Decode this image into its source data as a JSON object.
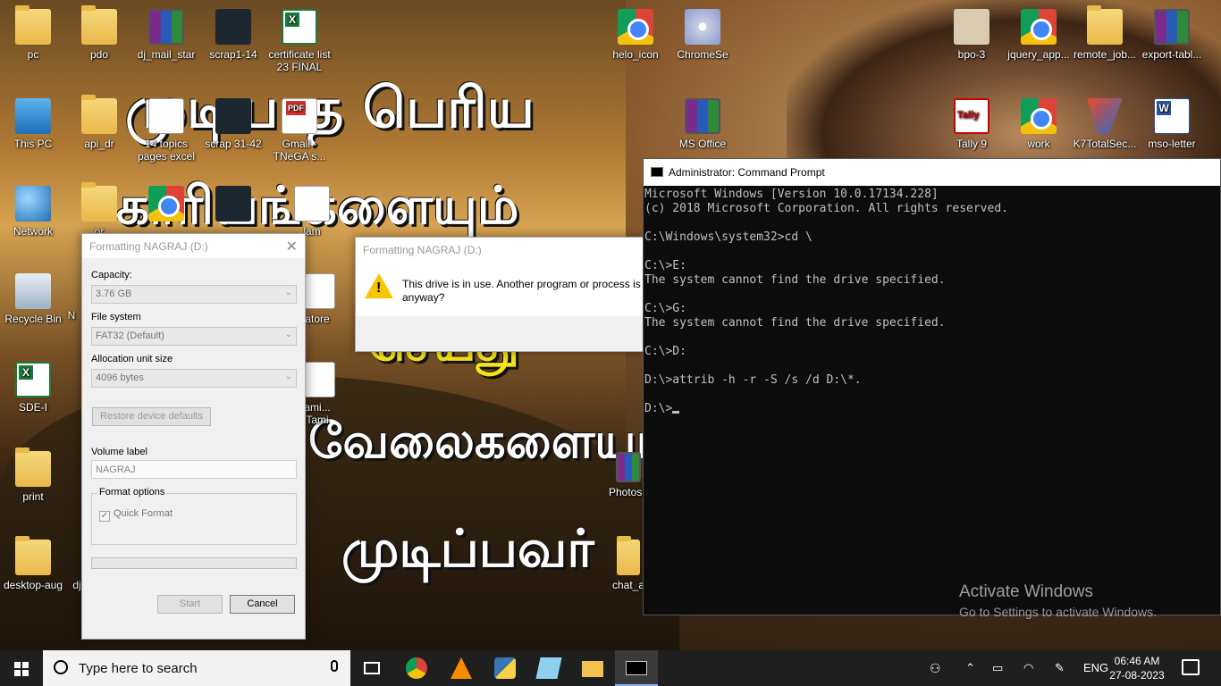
{
  "desktop": {
    "icons": [
      {
        "label": "pc",
        "icon": "user-folder-icon"
      },
      {
        "label": "pdo",
        "icon": "document-folder-icon"
      },
      {
        "label": "dj_mail_star",
        "icon": "winrar-archive-icon"
      },
      {
        "label": "scrap1-14",
        "icon": "screenshot-file-icon"
      },
      {
        "label": "certificate list 23 FINAL",
        "icon": "excel-file-icon"
      },
      {
        "label": "This PC",
        "icon": "computer-icon"
      },
      {
        "label": "api_dr",
        "icon": "folder-icon"
      },
      {
        "label": "14 topics pages excel",
        "icon": "spreadsheet-file-icon"
      },
      {
        "label": "scrap 31-42",
        "icon": "screenshot-file-icon"
      },
      {
        "label": "Gmail - TNeGA s...",
        "icon": "pdf-file-icon"
      },
      {
        "label": "Network",
        "icon": "network-icon"
      },
      {
        "label": "Recycle Bin",
        "icon": "recycle-bin-icon"
      },
      {
        "label": "SDE-I",
        "icon": "excel-file-icon"
      },
      {
        "label": "print",
        "icon": "document-folder-icon"
      },
      {
        "label": "desktop-aug",
        "icon": "document-folder-icon"
      },
      {
        "label": "helo_icon",
        "icon": "chrome-icon"
      },
      {
        "label": "ChromeSe",
        "icon": "cd-installer-icon"
      },
      {
        "label": "MS Office",
        "icon": "winrar-archive-icon"
      },
      {
        "label": "Photosh",
        "icon": "winrar-archive-icon"
      },
      {
        "label": "chat_a",
        "icon": "folder-icon"
      },
      {
        "label": "bpo-3",
        "icon": "image-file-icon"
      },
      {
        "label": "jquery_app...",
        "icon": "chrome-icon"
      },
      {
        "label": "remote_job...",
        "icon": "document-folder-icon"
      },
      {
        "label": "export-tabl...",
        "icon": "winrar-archive-icon"
      },
      {
        "label": "Tally 9",
        "icon": "tally-icon"
      },
      {
        "label": "work",
        "icon": "chrome-icon"
      },
      {
        "label": "K7TotalSec...",
        "icon": "k7-antivirus-icon"
      },
      {
        "label": "mso-letter",
        "icon": "word-file-icon"
      }
    ],
    "partial_labels": {
      "or": "or",
      "lam": "lam",
      "atore": "atore",
      "ami": "ami...",
      "tami": "Tami",
      "n": "N",
      "dj": "dj"
    },
    "wallpaper_text": {
      "line1": "முடியாத பெரிய",
      "line2": "காரியங்களையும்",
      "line3": "செய்து",
      "line4": "வேலைகளையும்",
      "line5": "முடிப்பவர்"
    }
  },
  "format_dialog": {
    "title": "Formatting NAGRAJ (D:)",
    "capacity_label": "Capacity:",
    "capacity_value": "3.76 GB",
    "filesystem_label": "File system",
    "filesystem_value": "FAT32 (Default)",
    "allocation_label": "Allocation unit size",
    "allocation_value": "4096 bytes",
    "restore_button": "Restore device defaults",
    "volume_label_label": "Volume label",
    "volume_label_value": "NAGRAJ",
    "format_options_label": "Format options",
    "quick_format_label": "Quick Format",
    "quick_format_checked": true,
    "progress": 0,
    "start_button": "Start",
    "cancel_button": "Cancel"
  },
  "warning_dialog": {
    "title": "Formatting NAGRAJ (D:)",
    "message_line1": "This drive is in use. Another program or process is u",
    "message_line2": "anyway?"
  },
  "cmd_window": {
    "title": "Administrator: Command Prompt",
    "lines": [
      "Microsoft Windows [Version 10.0.17134.228]",
      "(c) 2018 Microsoft Corporation. All rights reserved.",
      "",
      "C:\\Windows\\system32>cd \\",
      "",
      "C:\\>E:",
      "The system cannot find the drive specified.",
      "",
      "C:\\>G:",
      "The system cannot find the drive specified.",
      "",
      "C:\\>D:",
      "",
      "D:\\>attrib -h -r -S /s /d D:\\*.",
      "",
      "D:\\>"
    ]
  },
  "watermark": {
    "title": "Activate Windows",
    "subtitle": "Go to Settings to activate Windows."
  },
  "taskbar": {
    "search_placeholder": "Type here to search",
    "apps": [
      "task-view-icon",
      "chrome-icon",
      "vlc-icon",
      "python-idle-icon",
      "notepad-icon",
      "file-explorer-icon",
      "command-prompt-icon"
    ],
    "language": "ENG",
    "time": "06:46 AM",
    "date": "27-08-2023"
  }
}
